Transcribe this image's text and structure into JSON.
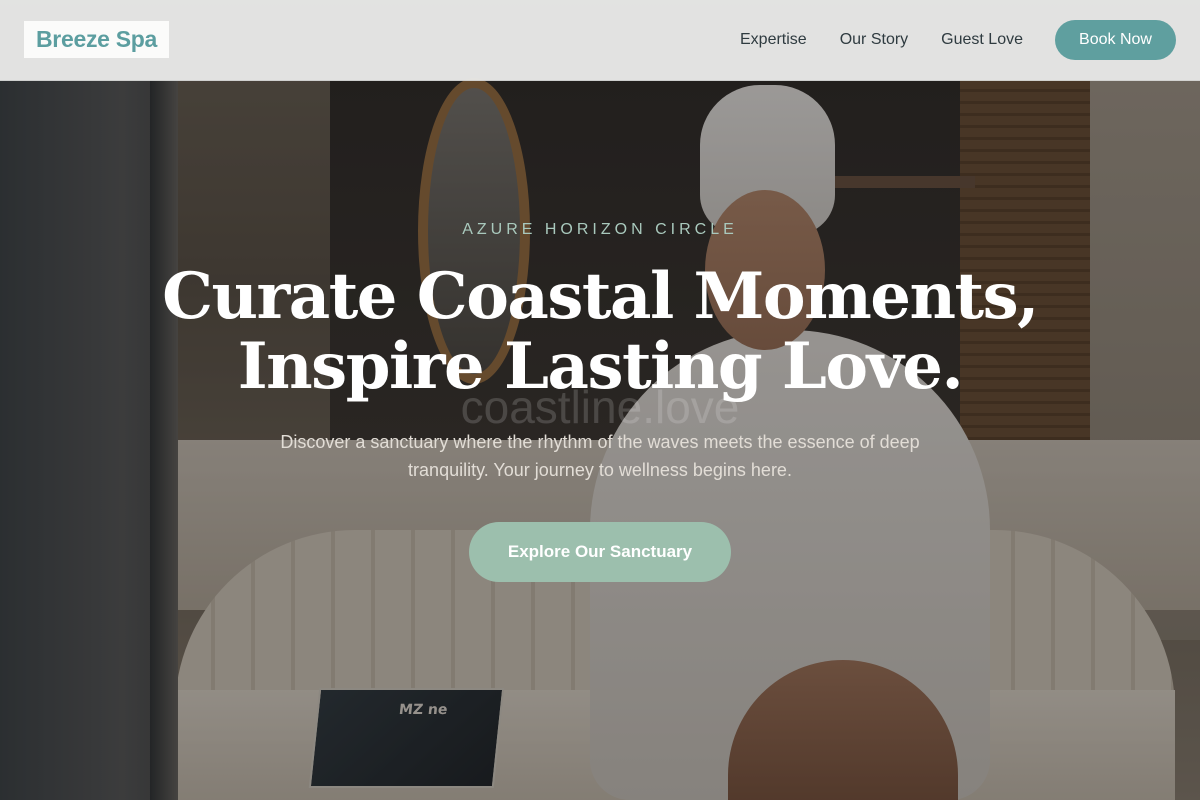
{
  "header": {
    "logo": "Breeze Spa",
    "nav": [
      "Expertise",
      "Our Story",
      "Guest Love"
    ],
    "book_label": "Book Now"
  },
  "hero": {
    "eyebrow": "AZURE HORIZON CIRCLE",
    "headline_line1": "Curate Coastal Moments,",
    "headline_line2": "Inspire Lasting Love.",
    "watermark": "coastline.love",
    "subtext": "Discover a sanctuary where the rhythm of the waves meets the essence of deep tranquility. Your journey to wellness begins here.",
    "cta_label": "Explore Our Sanctuary",
    "magazine_text": "MZ ne"
  },
  "colors": {
    "brand_teal": "#5f9f9f",
    "cta_sage": "#9cbfad",
    "eyebrow": "#a9c9bd"
  }
}
